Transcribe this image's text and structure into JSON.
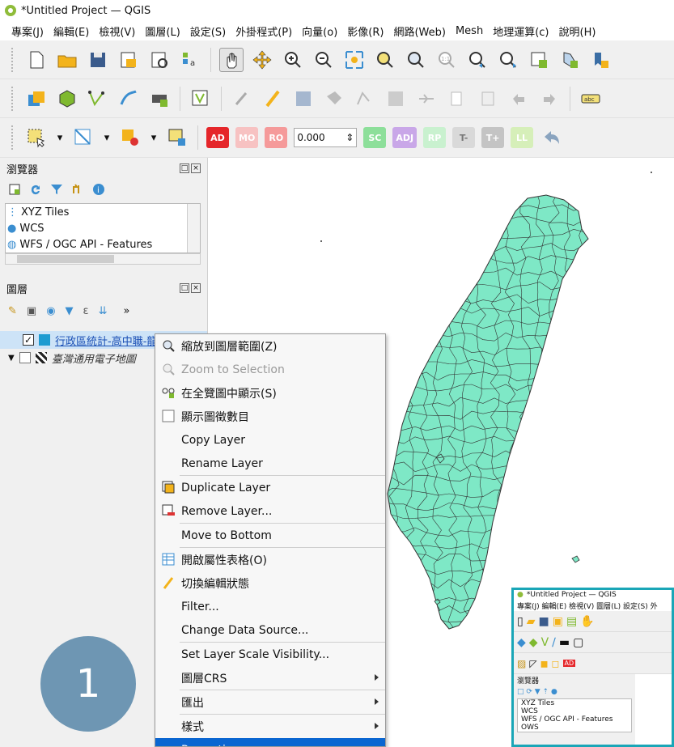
{
  "window": {
    "title": "*Untitled Project — QGIS"
  },
  "menubar": [
    "專案(J)",
    "編輯(E)",
    "檢視(V)",
    "圖層(L)",
    "設定(S)",
    "外掛程式(P)",
    "向量(o)",
    "影像(R)",
    "網路(Web)",
    "Mesh",
    "地理運算(c)",
    "說明(H)"
  ],
  "digitize": {
    "tolerance_value": "0.000",
    "labels": [
      "AD",
      "MO",
      "RO",
      "SC",
      "ADJ",
      "RP",
      "T-",
      "T+",
      "LL"
    ]
  },
  "browser_panel": {
    "title": "瀏覽器",
    "items": [
      "XYZ Tiles",
      "WCS",
      "WFS / OGC API - Features"
    ]
  },
  "layers_panel": {
    "title": "圖層",
    "layers": [
      {
        "name": "行政區統計-高中職-龍目",
        "checked": true
      },
      {
        "name": "臺灣通用電子地圖",
        "checked": false
      }
    ]
  },
  "context_menu": {
    "items": [
      {
        "label": "縮放到圖層範圍(Z)",
        "icon": "zoom-layer-icon",
        "state": "normal"
      },
      {
        "label": "Zoom to Selection",
        "icon": "zoom-selection-icon",
        "state": "disabled"
      },
      {
        "label": "在全覽圖中顯示(S)",
        "icon": "overview-icon",
        "state": "normal"
      },
      {
        "label": "顯示圖徵數目",
        "icon": "checkbox-icon",
        "state": "normal"
      },
      {
        "label": "Copy Layer",
        "icon": "",
        "state": "normal"
      },
      {
        "label": "Rename Layer",
        "icon": "",
        "state": "normal"
      },
      {
        "sep": true
      },
      {
        "label": "Duplicate Layer",
        "icon": "duplicate-layer-icon",
        "state": "normal"
      },
      {
        "label": "Remove Layer...",
        "icon": "remove-layer-icon",
        "state": "normal"
      },
      {
        "sep": true
      },
      {
        "label": "Move to Bottom",
        "icon": "",
        "state": "normal"
      },
      {
        "sep": true
      },
      {
        "label": "開啟屬性表格(O)",
        "icon": "attribute-table-icon",
        "state": "normal"
      },
      {
        "label": "切換編輯狀態",
        "icon": "pencil-icon",
        "state": "normal"
      },
      {
        "label": "Filter...",
        "icon": "",
        "state": "normal"
      },
      {
        "label": "Change Data Source...",
        "icon": "",
        "state": "normal"
      },
      {
        "sep": true
      },
      {
        "label": "Set Layer Scale Visibility...",
        "icon": "",
        "state": "normal"
      },
      {
        "label": "圖層CRS",
        "icon": "",
        "state": "normal",
        "submenu": true
      },
      {
        "sep": true
      },
      {
        "label": "匯出",
        "icon": "",
        "state": "normal",
        "submenu": true
      },
      {
        "sep": true
      },
      {
        "label": "樣式",
        "icon": "",
        "state": "normal",
        "submenu": true
      },
      {
        "label": "Properties...",
        "icon": "",
        "state": "highlight"
      }
    ]
  },
  "step_badge": "1",
  "inset": {
    "title": "*Untitled Project — QGIS",
    "menu": "專案(J)  編輯(E)  檢視(V)  圖層(L)  設定(S)  外",
    "panel_title": "瀏覽器",
    "items": [
      "XYZ Tiles",
      "WCS",
      "WFS / OGC API - Features",
      "OWS"
    ]
  },
  "colors": {
    "map_fill": "#7ee8c6",
    "map_stroke": "#333333",
    "menu_highlight": "#0a66d1",
    "badge": "#6e96b3",
    "inset_border": "#1aa6b7"
  }
}
